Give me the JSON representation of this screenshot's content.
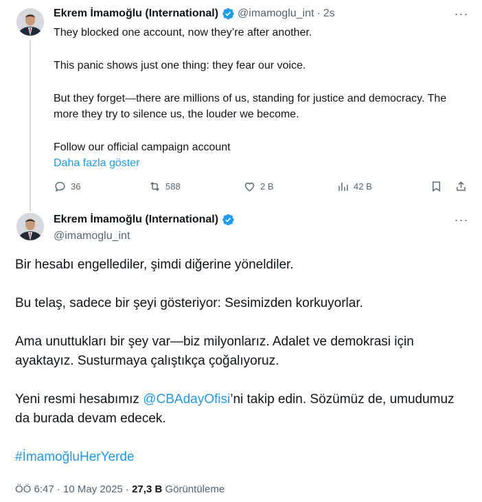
{
  "reply_tweet": {
    "display_name": "Ekrem İmamoğlu (International)",
    "handle": "@imamoglu_int",
    "separator": "·",
    "time": "2s",
    "more_label": "···",
    "paragraphs": [
      "They blocked one account, now they’re after another.",
      "This panic shows just one thing: they fear our voice.",
      "But they forget—there are millions of us, standing for justice and democracy. The more they try to silence us, the louder we become.",
      "Follow our official campaign account"
    ],
    "show_more": "Daha fazla göster",
    "replies": "36",
    "reposts": "588",
    "likes": "2 B",
    "views": "42 B"
  },
  "main_tweet": {
    "display_name": "Ekrem İmamoğlu (International)",
    "handle": "@imamoglu_int",
    "more_label": "···",
    "para1": "Bir hesabı engellediler, şimdi diğerine yöneldiler.",
    "para2": "Bu telaş, sadece bir şeyi gösteriyor: Sesimizden korkuyorlar.",
    "para3": "Ama unuttukları bir şey var—biz milyonlarız. Adalet ve demokrasi için ayaktayız. Susturmaya çalıştıkça çoğalıyoruz.",
    "para4_pre": "Yeni resmi hesabımız ",
    "para4_mention": "@CBAdayOfisi",
    "para4_post": "’ni takip edin. Sözümüz de, umudumuz da burada devam edecek.",
    "hashtag": "#İmamoğluHerYerde",
    "timestamp": "ÖÖ 6:47 · 10 May 2025 · ",
    "views_count": "27,3 B",
    "views_label": " Görüntüleme"
  },
  "colors": {
    "accent": "#1d9bf0",
    "secondary_text": "#536471",
    "primary_text": "#0f1419",
    "thread_line": "#cfd9de"
  },
  "icons": [
    "verified-badge-icon",
    "more-icon",
    "reply-icon",
    "repost-icon",
    "like-icon",
    "views-icon",
    "bookmark-icon",
    "share-icon"
  ]
}
